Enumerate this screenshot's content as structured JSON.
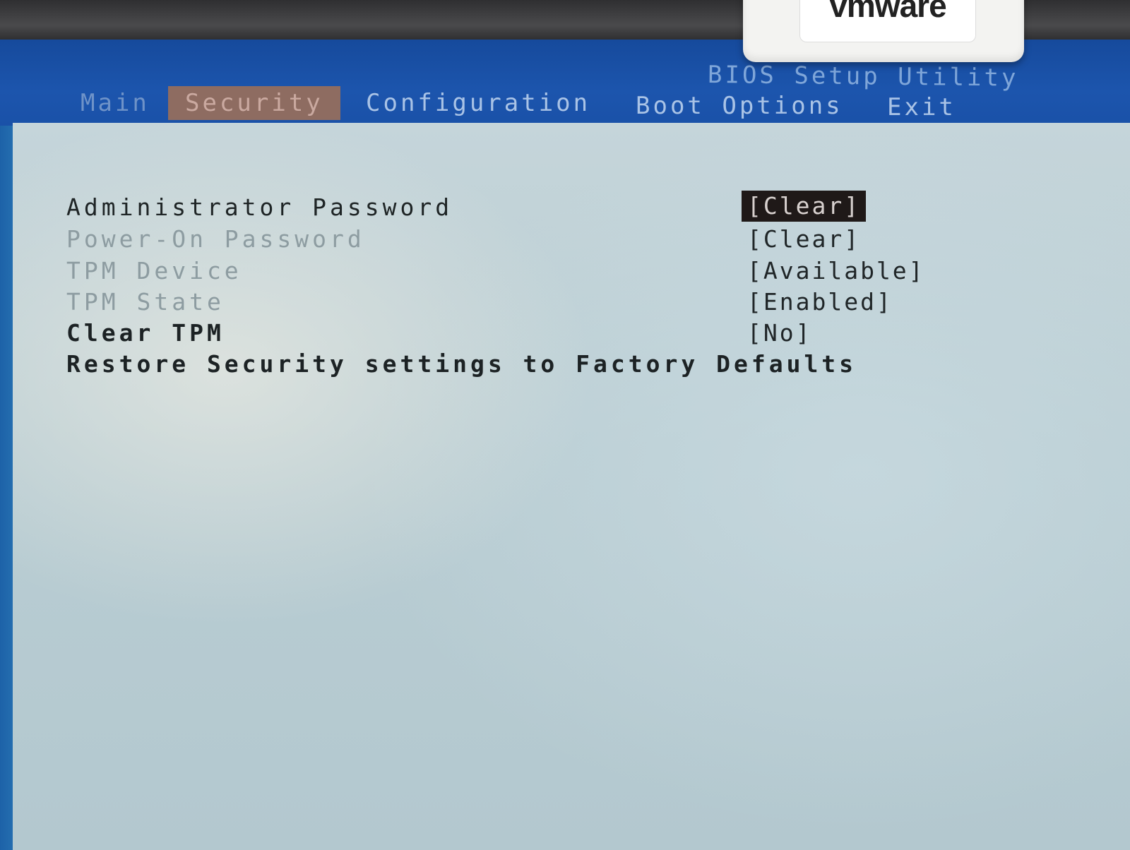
{
  "bezel": {
    "sticker_brand": "vmware"
  },
  "header": {
    "utility_title": "BIOS Setup Utility"
  },
  "tabs": [
    {
      "label": "Main"
    },
    {
      "label": "Security",
      "selected": true
    },
    {
      "label": "Configuration"
    },
    {
      "label": "Boot Options"
    },
    {
      "label": "Exit"
    }
  ],
  "security": {
    "items": [
      {
        "label": "Administrator Password",
        "value": "[Clear]",
        "selected": true
      },
      {
        "label": "Power-On Password",
        "value": "[Clear]"
      },
      {
        "label": "TPM Device",
        "value": "[Available]"
      },
      {
        "label": "TPM State",
        "value": "[Enabled]"
      },
      {
        "label": "Clear TPM",
        "value": "[No]"
      },
      {
        "label": "Restore Security settings to Factory Defaults"
      }
    ]
  },
  "colors": {
    "menubar_blue": "#1a51a8",
    "panel_bg": "#c5d5da",
    "selected_tab_bg": "#8e6c61",
    "selected_value_bg": "#1f1918"
  }
}
